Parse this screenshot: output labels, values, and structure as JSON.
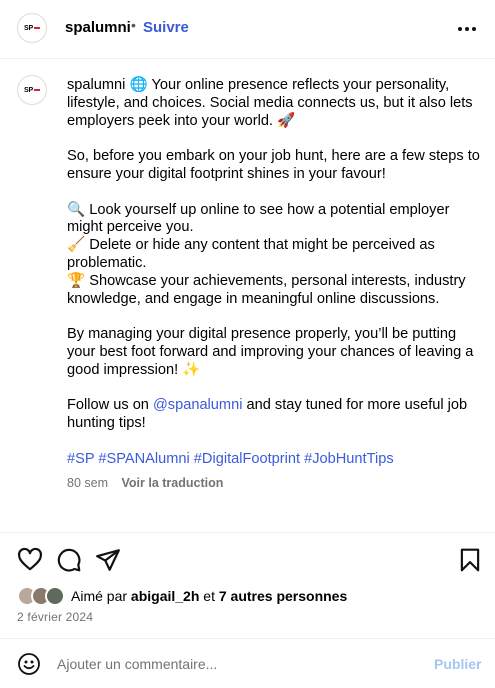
{
  "header": {
    "avatar_text": "SP",
    "username": "spalumni",
    "separator": "•",
    "follow_label": "Suivre"
  },
  "caption": {
    "avatar_text": "SP",
    "username": "spalumni",
    "line1_emoji": "🌐",
    "line1_text": "Your online presence reflects your personality, lifestyle, and choices. Social media connects us, but it also lets employers peek into your world. 🚀",
    "paragraph2": "So, before you embark on your job hunt, here are a few steps to ensure your digital footprint shines in your favour!",
    "step1": "🔍 Look yourself up online to see how a potential employer might perceive you.",
    "step2": "🧹 Delete or hide any content that might be perceived as problematic.",
    "step3": "🏆 Showcase your achievements, personal interests, industry knowledge, and engage in meaningful online discussions.",
    "paragraph4": "By managing your digital presence properly, you’ll be putting your best foot forward and improving your chances of leaving a good impression! ✨",
    "follow_prefix": "Follow us on ",
    "mention": "@spanalumni",
    "follow_suffix": " and stay tuned for more useful job hunting tips!",
    "hashtags": "#SP #SPANAlumni #DigitalFootprint #JobHuntTips"
  },
  "meta": {
    "age": "80 sem",
    "translate_label": "Voir la traduction"
  },
  "actions": {
    "like_icon": "heart-icon",
    "comment_icon": "comment-icon",
    "share_icon": "send-icon",
    "save_icon": "bookmark-icon"
  },
  "likes": {
    "prefix": "Aimé par ",
    "user": "abigail_2h",
    "middle": " et ",
    "others": "7 autres personnes"
  },
  "date": "2 février 2024",
  "comment": {
    "placeholder": "Ajouter un commentaire...",
    "publish_label": "Publier"
  },
  "colors": {
    "accent": "#3b5bdb",
    "publish_disabled": "#a7c4f2",
    "muted": "#737373",
    "brand_red": "#d8223b"
  }
}
